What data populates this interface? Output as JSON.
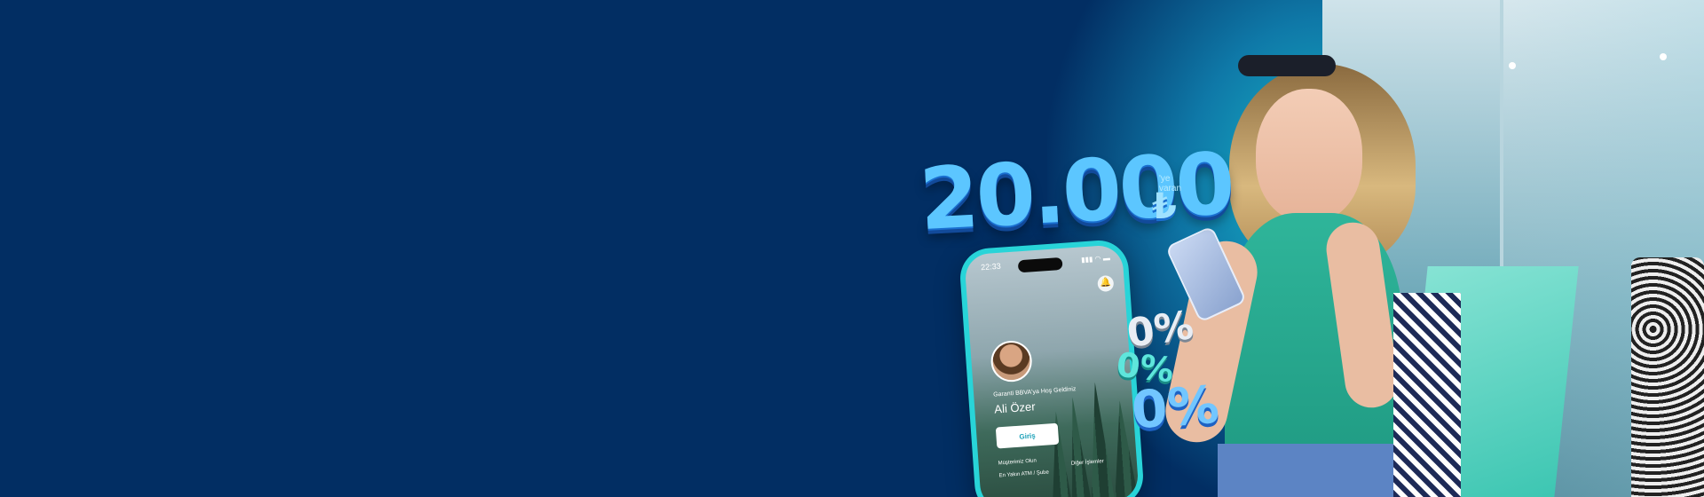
{
  "promo": {
    "amount": "20.000",
    "currency": "₺",
    "suffix": "'ye varan"
  },
  "phone": {
    "status_time": "22:33",
    "status_icons": "▮▮▮ ◠ ▬",
    "bell_icon": "bell-icon",
    "greeting": "Garanti BBVA'ya Hoş Geldiniz",
    "user_name": "Ali Özer",
    "login_label": "Giriş",
    "customer_link": "Müşterimiz Olun",
    "closest_branch": "En Yakın ATM / Şube",
    "other_ops": "Diğer İşlemler"
  },
  "percent_balloons": [
    "0%",
    "0%",
    "0%"
  ],
  "colors": {
    "background": "#022e63",
    "accent_teal": "#28d4d8",
    "amount_blue": "#5cc6ff"
  }
}
